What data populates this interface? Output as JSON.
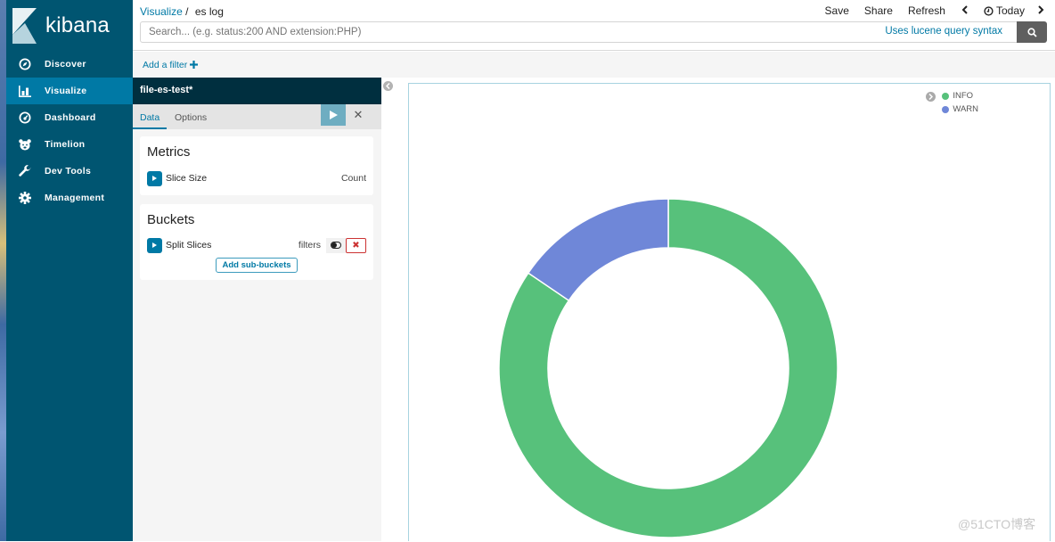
{
  "app": {
    "name": "kibana"
  },
  "sidebar": {
    "items": [
      {
        "label": "Discover",
        "icon": "compass-icon",
        "active": false
      },
      {
        "label": "Visualize",
        "icon": "bar-chart-icon",
        "active": true
      },
      {
        "label": "Dashboard",
        "icon": "dashboard-gauge-icon",
        "active": false
      },
      {
        "label": "Timelion",
        "icon": "timelion-bear-icon",
        "active": false
      },
      {
        "label": "Dev Tools",
        "icon": "wrench-icon",
        "active": false
      },
      {
        "label": "Management",
        "icon": "gear-icon",
        "active": false
      }
    ]
  },
  "header": {
    "breadcrumb_root": "Visualize",
    "breadcrumb_sep": "/",
    "breadcrumb_current": "es log",
    "actions": {
      "save": "Save",
      "share": "Share",
      "refresh": "Refresh",
      "time": "Today"
    },
    "search": {
      "placeholder": "Search... (e.g. status:200 AND extension:PHP)",
      "value": "",
      "syntax_link": "Uses lucene query syntax"
    }
  },
  "filter_bar": {
    "add_filter": "Add a filter"
  },
  "editor": {
    "index_pattern": "file-es-test*",
    "tabs": [
      "Data",
      "Options"
    ],
    "active_tab": "Data",
    "metrics": {
      "title": "Metrics",
      "rows": [
        {
          "label": "Slice Size",
          "value": "Count"
        }
      ]
    },
    "buckets": {
      "title": "Buckets",
      "rows": [
        {
          "label": "Split Slices",
          "value": "filters"
        }
      ],
      "add_sub_buckets": "Add sub-buckets"
    }
  },
  "chart_data": {
    "type": "pie",
    "donut": true,
    "title": "",
    "legend_position": "top-right",
    "categories": [
      "INFO",
      "WARN"
    ],
    "values": [
      84.5,
      15.5
    ],
    "colors": [
      "#57c17b",
      "#6f87d8"
    ]
  },
  "watermark": "@51CTO博客"
}
